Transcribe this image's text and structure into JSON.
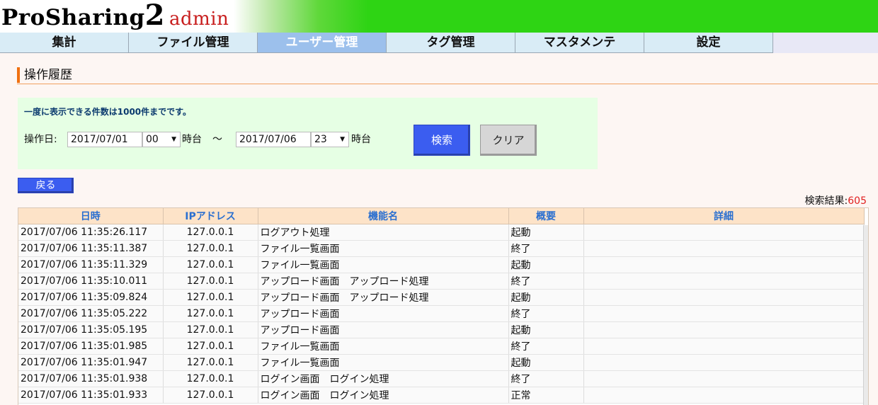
{
  "header": {
    "logo_main": "ProSharing",
    "logo_num": "2",
    "logo_sub": "admin"
  },
  "nav": {
    "items": [
      {
        "label": "集計"
      },
      {
        "label": "ファイル管理"
      },
      {
        "label": "ユーザー管理",
        "active": true
      },
      {
        "label": "タグ管理"
      },
      {
        "label": "マスタメンテ"
      },
      {
        "label": "設定"
      }
    ]
  },
  "page": {
    "title": "操作履歴"
  },
  "search": {
    "notice": "一度に表示できる件数は1000件までです。",
    "date_label": "操作日:",
    "from_date": "2017/07/01",
    "from_hour": "00",
    "hour_unit_1": "時台",
    "range_sep": "～",
    "to_date": "2017/07/06",
    "to_hour": "23",
    "hour_unit_2": "時台",
    "search_button": "検索",
    "clear_button": "クリア"
  },
  "back_button": "戻る",
  "result": {
    "label": "検索結果:",
    "count": "605"
  },
  "table": {
    "columns": [
      "日時",
      "IPアドレス",
      "機能名",
      "概要",
      "詳細"
    ],
    "rows": [
      [
        "2017/07/06 11:35:26.117",
        "127.0.0.1",
        "ログアウト処理",
        "起動",
        ""
      ],
      [
        "2017/07/06 11:35:11.387",
        "127.0.0.1",
        "ファイル一覧画面",
        "終了",
        ""
      ],
      [
        "2017/07/06 11:35:11.329",
        "127.0.0.1",
        "ファイル一覧画面",
        "起動",
        ""
      ],
      [
        "2017/07/06 11:35:10.011",
        "127.0.0.1",
        "アップロード画面　アップロード処理",
        "終了",
        ""
      ],
      [
        "2017/07/06 11:35:09.824",
        "127.0.0.1",
        "アップロード画面　アップロード処理",
        "起動",
        ""
      ],
      [
        "2017/07/06 11:35:05.222",
        "127.0.0.1",
        "アップロード画面",
        "終了",
        ""
      ],
      [
        "2017/07/06 11:35:05.195",
        "127.0.0.1",
        "アップロード画面",
        "起動",
        ""
      ],
      [
        "2017/07/06 11:35:01.985",
        "127.0.0.1",
        "ファイル一覧画面",
        "終了",
        ""
      ],
      [
        "2017/07/06 11:35:01.947",
        "127.0.0.1",
        "ファイル一覧画面",
        "起動",
        ""
      ],
      [
        "2017/07/06 11:35:01.938",
        "127.0.0.1",
        "ログイン画面　ログイン処理",
        "終了",
        ""
      ],
      [
        "2017/07/06 11:35:01.933",
        "127.0.0.1",
        "ログイン画面　ログイン処理",
        "正常",
        ""
      ]
    ]
  }
}
